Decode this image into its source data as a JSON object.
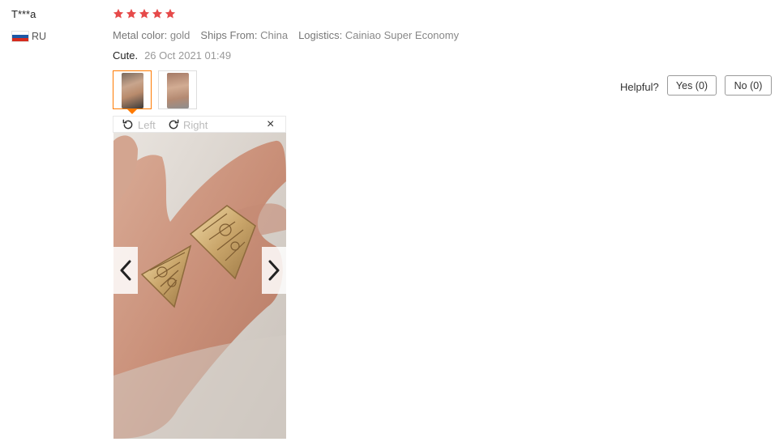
{
  "review": {
    "username": "T***a",
    "country": "RU",
    "rating": 5,
    "attributes": [
      {
        "key": "Metal color:",
        "value": "gold"
      },
      {
        "key": "Ships From:",
        "value": "China"
      },
      {
        "key": "Logistics:",
        "value": "Cainiao Super Economy"
      }
    ],
    "text": "Cute.",
    "date": "26 Oct 2021 01:49"
  },
  "helpful": {
    "label": "Helpful?",
    "yes_label": "Yes (0)",
    "no_label": "No (0)"
  },
  "viewer": {
    "rotate_left_label": "Left",
    "rotate_right_label": "Right",
    "close_label": "×"
  },
  "colors": {
    "star": "#e64a4a",
    "active_border": "#ff7a00",
    "flag_white": "#ffffff",
    "flag_blue": "#1c57a5",
    "flag_red": "#d52b1e"
  }
}
